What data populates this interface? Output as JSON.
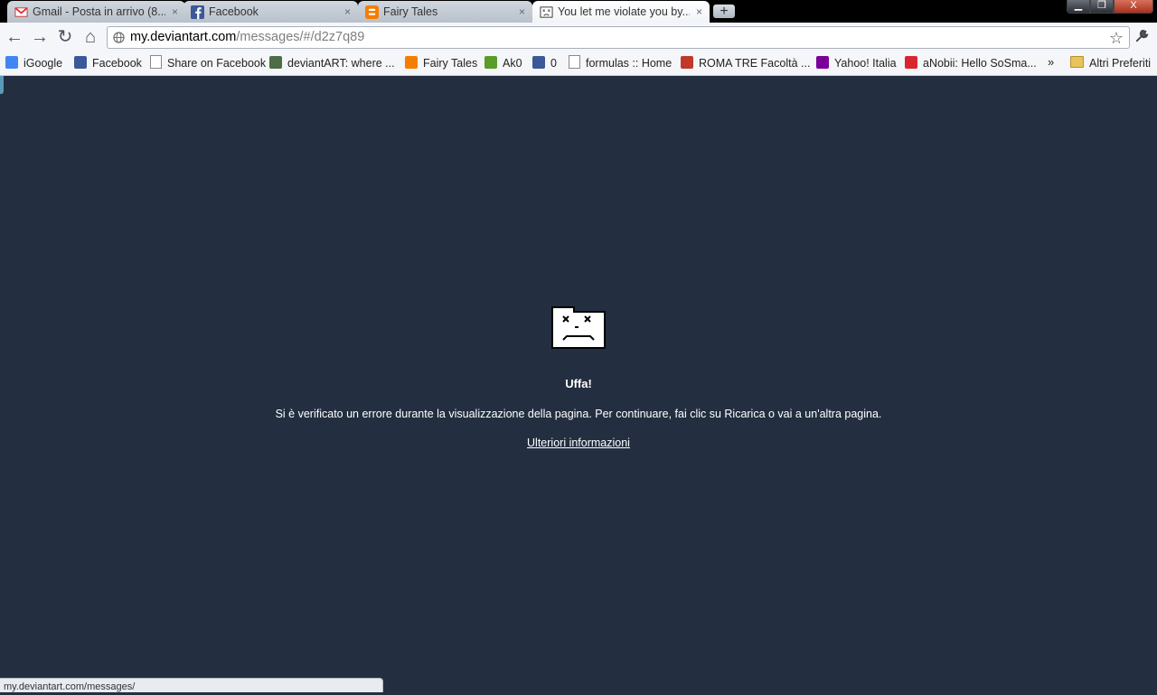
{
  "tabs": [
    {
      "title": "Gmail - Posta in arrivo (8...",
      "icon": "gmail-icon",
      "active": false
    },
    {
      "title": "Facebook",
      "icon": "facebook-icon",
      "active": false
    },
    {
      "title": "Fairy Tales",
      "icon": "blogger-icon",
      "active": false
    },
    {
      "title": "You let me violate you by...",
      "icon": "sad-tab-icon",
      "active": true
    }
  ],
  "tab_close_glyph": "×",
  "newtab_glyph": "+",
  "window": {
    "min": "▁",
    "max": "❐",
    "close": "X"
  },
  "toolbar": {
    "back": "←",
    "forward": "→",
    "reload": "↻",
    "home": "⌂",
    "url_host": "my.deviantart.com",
    "url_path": "/messages/#/d2z7q89",
    "star": "☆",
    "wrench": "🔧"
  },
  "bookmarks": [
    {
      "label": "iGoogle",
      "icon": "igoogle-icon",
      "color": "#4285f4"
    },
    {
      "label": "Facebook",
      "icon": "facebook-icon",
      "color": "#3b5998"
    },
    {
      "label": "Share on Facebook",
      "icon": "page-icon",
      "color": "#ffffff"
    },
    {
      "label": "deviantART: where ...",
      "icon": "deviantart-icon",
      "color": "#4e6c45"
    },
    {
      "label": "Fairy Tales",
      "icon": "blogger-icon",
      "color": "#f57d00"
    },
    {
      "label": "Ak0",
      "icon": "ak0-icon",
      "color": "#5a9b2a"
    },
    {
      "label": "0",
      "icon": "facebook-icon",
      "color": "#3b5998"
    },
    {
      "label": "formulas :: Home",
      "icon": "page-icon",
      "color": "#ffffff"
    },
    {
      "label": "ROMA TRE Facoltà ...",
      "icon": "romatre-icon",
      "color": "#c0392b"
    },
    {
      "label": "Yahoo! Italia",
      "icon": "yahoo-icon",
      "color": "#7b0099"
    },
    {
      "label": "aNobii: Hello SoSma...",
      "icon": "anobii-icon",
      "color": "#d9262e"
    }
  ],
  "bookmarks_overflow": "»",
  "other_bookmarks": "Altri Preferiti",
  "error": {
    "title": "Uffa!",
    "message": "Si è verificato un errore durante la visualizzazione della pagina. Per continuare, fai clic su Ricarica o vai a un'altra pagina.",
    "link": "Ulteriori informazioni"
  },
  "status_bar": "my.deviantart.com/messages/"
}
